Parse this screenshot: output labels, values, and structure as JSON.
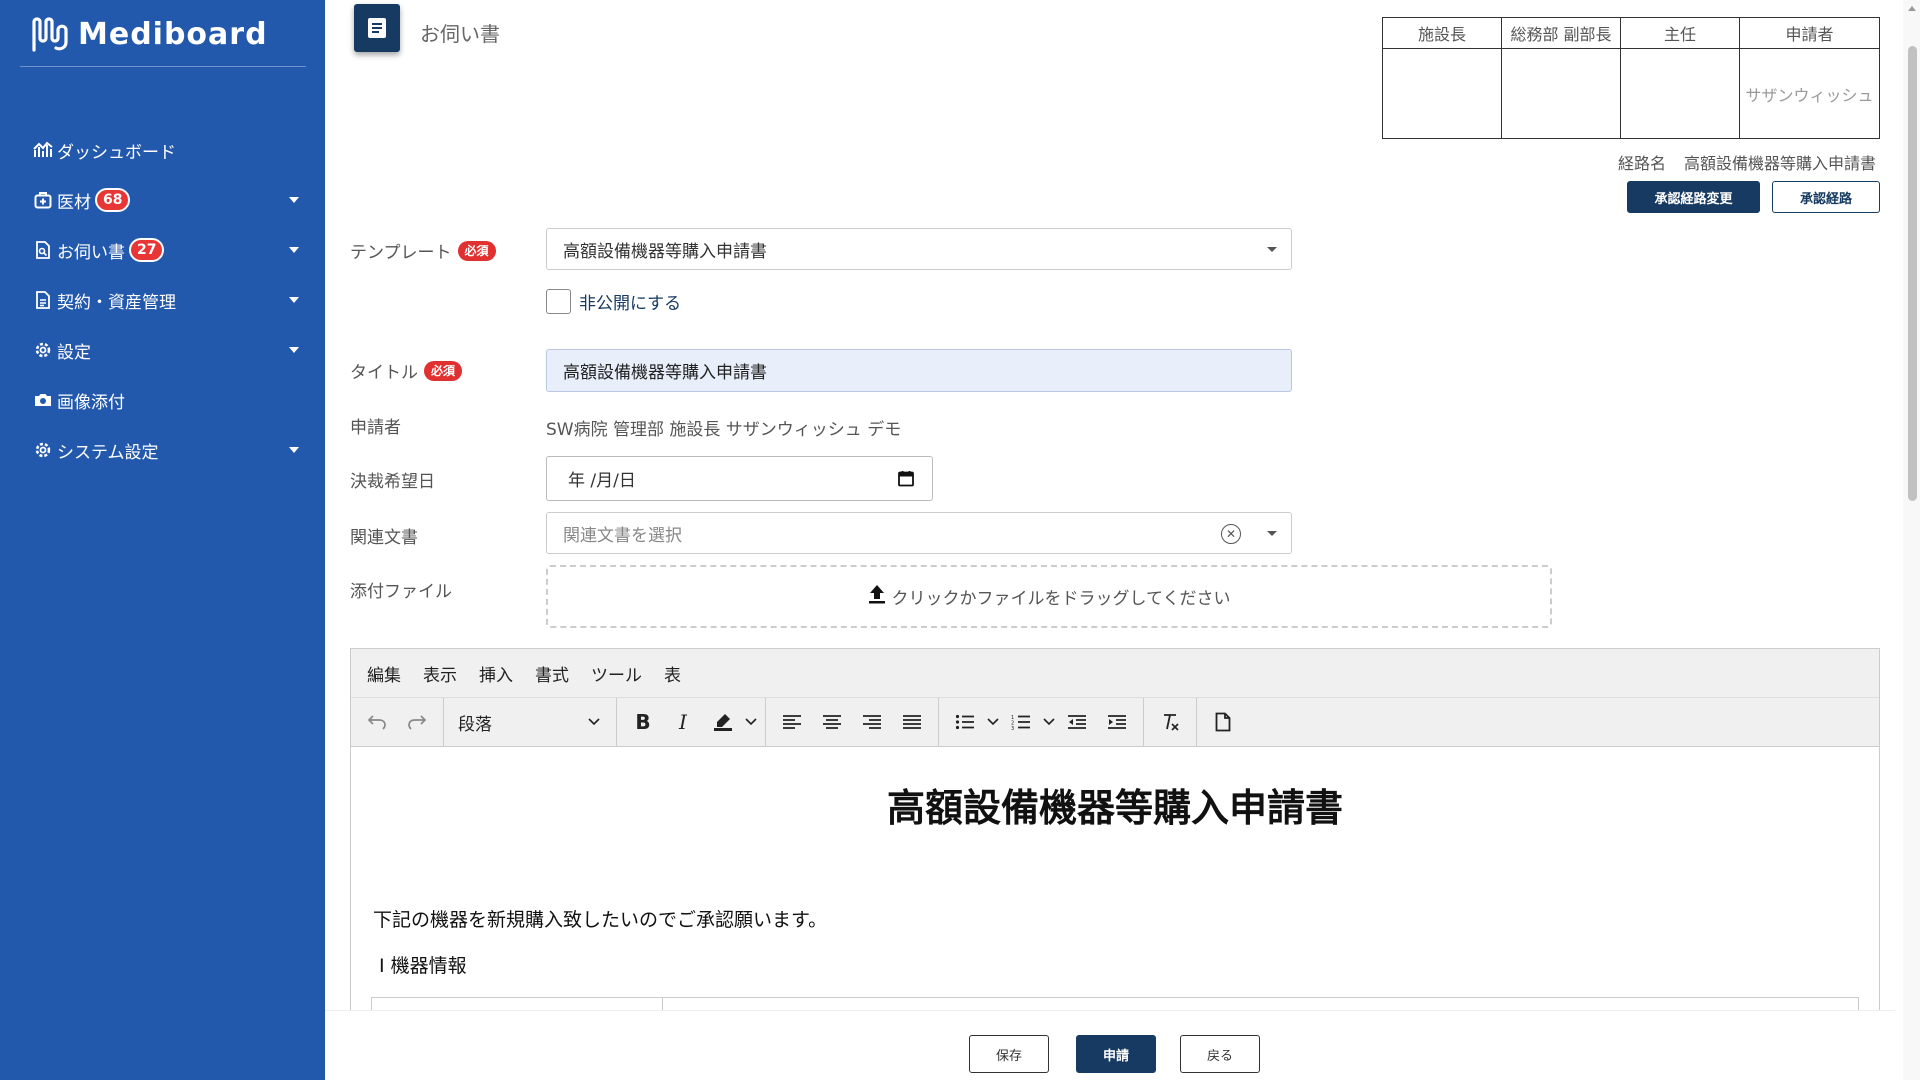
{
  "app": {
    "brand": "Mediboard"
  },
  "sidebar": {
    "items": [
      {
        "label": "ダッシュボード",
        "icon": "chart-icon"
      },
      {
        "label": "医材",
        "icon": "medical-kit-icon",
        "badge": "68",
        "expandable": true
      },
      {
        "label": "お伺い書",
        "icon": "document-search-icon",
        "badge": "27",
        "expandable": true
      },
      {
        "label": "契約・資産管理",
        "icon": "contract-icon",
        "expandable": true
      },
      {
        "label": "設定",
        "icon": "gear-icon",
        "expandable": true
      },
      {
        "label": "画像添付",
        "icon": "camera-icon"
      },
      {
        "label": "システム設定",
        "icon": "gear-icon",
        "expandable": true
      }
    ]
  },
  "header": {
    "title": "お伺い書"
  },
  "approval": {
    "columns": [
      "施設長",
      "総務部 副部長",
      "主任",
      "申請者"
    ],
    "stamps": [
      "",
      "",
      "",
      "サザンウィッシュ"
    ],
    "route_label": "経路名",
    "route_name": "高額設備機器等購入申請書",
    "change_route_button": "承認経路変更",
    "route_button": "承認経路"
  },
  "form": {
    "required_badge": "必須",
    "template": {
      "label": "テンプレート",
      "value": "高額設備機器等購入申請書"
    },
    "private_checkbox": {
      "label": "非公開にする",
      "checked": false
    },
    "title": {
      "label": "タイトル",
      "value": "高額設備機器等購入申請書"
    },
    "applicant": {
      "label": "申請者",
      "value": "SW病院 管理部 施設長 サザンウィッシュ デモ"
    },
    "desired_date": {
      "label": "決裁希望日",
      "value": "年 /月/日"
    },
    "related_docs": {
      "label": "関連文書",
      "placeholder": "関連文書を選択"
    },
    "attachment": {
      "label": "添付ファイル",
      "dropzone_text": "クリックかファイルをドラッグしてください"
    }
  },
  "editor": {
    "menu": [
      "編集",
      "表示",
      "挿入",
      "書式",
      "ツール",
      "表"
    ],
    "block_format": "段落",
    "content": {
      "heading": "高額設備機器等購入申請書",
      "paragraph": "下記の機器を新規購入致したいのでご承認願います。",
      "section": "Ⅰ 機器情報"
    }
  },
  "footer": {
    "save": "保存",
    "submit": "申請",
    "back": "戻る"
  },
  "colors": {
    "sidebar": "#2359ad",
    "primary": "#163a61",
    "danger": "#e03030"
  }
}
